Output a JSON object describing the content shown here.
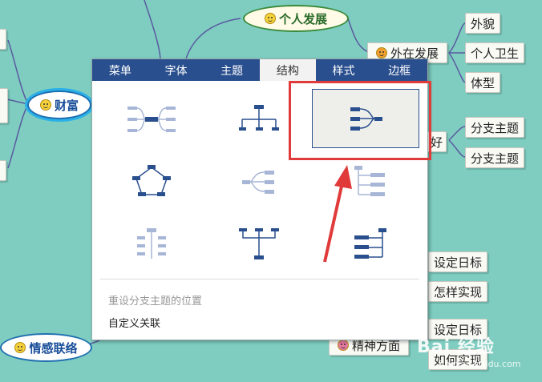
{
  "mindmap": {
    "nodes": {
      "personal_dev": "个人发展",
      "wealth": "财富",
      "emotion": "情感联络",
      "outer_dev": "外在发展",
      "appearance": "外貌",
      "hygiene": "个人卫生",
      "figure": "体型",
      "branch1": "分支主题",
      "branch2": "分支主题",
      "hao": "好",
      "set_goal1": "设定日标",
      "how1": "怎样实现",
      "set_goal2": "设定日标",
      "spirit": "精神方面",
      "how2": "如何实现"
    }
  },
  "panel": {
    "tabs": [
      "菜单",
      "字体",
      "主题",
      "结构",
      "样式",
      "边框"
    ],
    "active_tab": "结构",
    "menu": {
      "reset_label": "重设分支主题的位置",
      "custom_label": "自定义关联"
    }
  },
  "watermark": {
    "text": "Bai 经验",
    "sub": "jingyan.baidu.com"
  },
  "colors": {
    "background": "#7ecdc0",
    "tab_bar": "#2a4f8e",
    "highlight": "#e03a3a",
    "node_border": "#1f6fb0"
  }
}
